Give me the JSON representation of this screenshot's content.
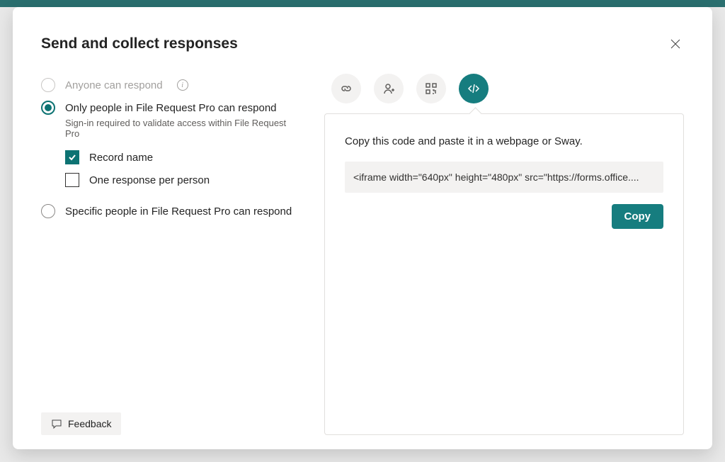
{
  "modal": {
    "title": "Send and collect responses"
  },
  "options": {
    "anyone": {
      "label": "Anyone can respond"
    },
    "org": {
      "label": "Only people in File Request Pro can respond",
      "sub": "Sign-in required to validate access within File Request Pro",
      "record_name": "Record name",
      "one_response": "One response per person"
    },
    "specific": {
      "label": "Specific people in File Request Pro can respond"
    }
  },
  "embed": {
    "instruction": "Copy this code and paste it in a webpage or Sway.",
    "code": "<iframe width=\"640px\" height=\"480px\" src=\"https://forms.office....",
    "copy_label": "Copy"
  },
  "feedback": {
    "label": "Feedback"
  }
}
